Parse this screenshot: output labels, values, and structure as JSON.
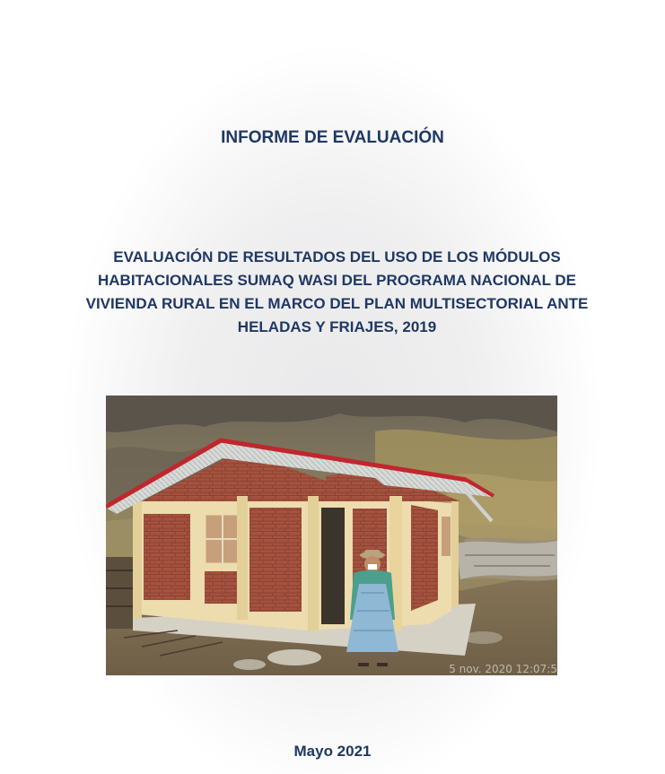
{
  "document": {
    "report_type": "INFORME DE EVALUACIÓN",
    "title_lines": [
      "EVALUACIÓN DE RESULTADOS DEL USO DE LOS MÓDULOS",
      "HABITACIONALES SUMAQ WASI DEL PROGRAMA NACIONAL DE",
      "VIVIENDA RURAL EN EL MARCO DEL PLAN MULTISECTORIAL ANTE",
      "HELADAS Y FRIAJES, 2019"
    ],
    "photo_timestamp": "5 nov. 2020 12:07:5",
    "date": "Mayo 2021"
  },
  "colors": {
    "heading": "#1f3864",
    "roof": "#c0272d",
    "brick": "#a5523f",
    "plaster": "#ecdcae"
  }
}
